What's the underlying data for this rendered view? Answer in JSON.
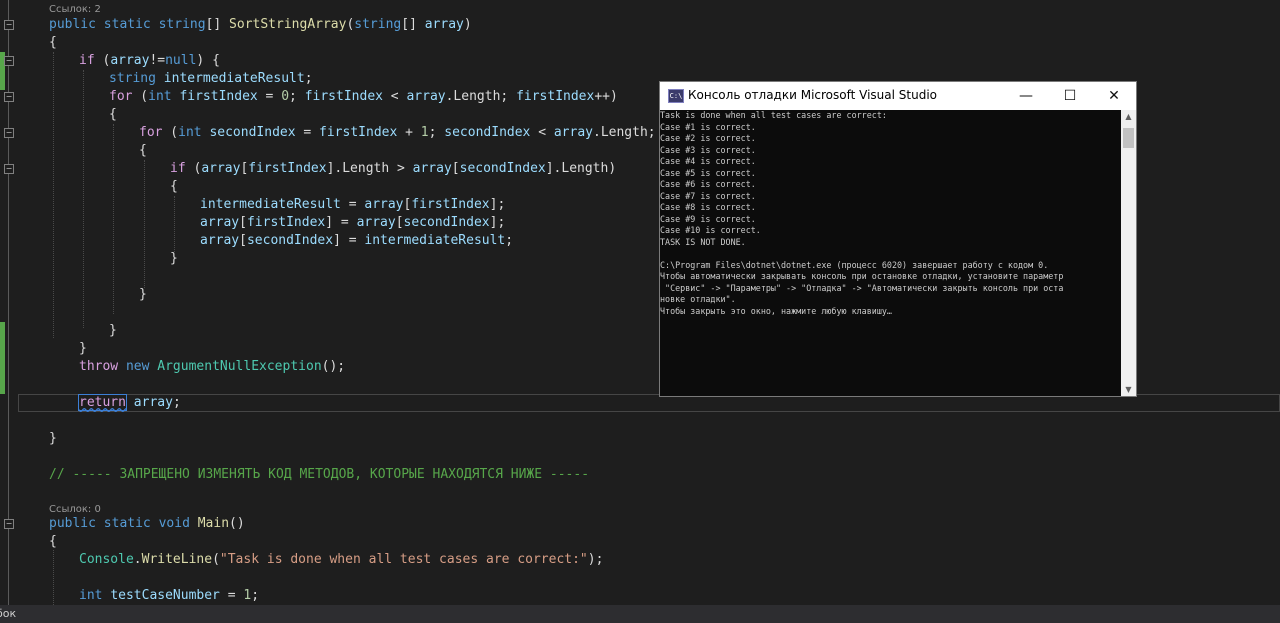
{
  "editor": {
    "refs_sort": "Ссылок: 2",
    "refs_main": "Ссылок: 0",
    "code": {
      "sig": {
        "kw1": "public",
        "kw2": "static",
        "type": "string",
        "arr": "[] ",
        "fn": "SortStringArray",
        "p1": "(",
        "ptype": "string",
        "p2": "[] ",
        "pname": "array",
        "p3": ")"
      },
      "l2": "{",
      "l3": {
        "ctl": "if",
        "a": " (",
        "v": "array",
        "b": "!=",
        "kw": "null",
        "c": ") {"
      },
      "l4": {
        "kw": "string",
        "v": "intermediateResult",
        "c": ";"
      },
      "l5": {
        "ctl": "for",
        "a": " (",
        "kw": "int",
        "v1": "firstIndex",
        "b": " = ",
        "num": "0",
        "c": "; ",
        "v2": "firstIndex",
        "d": " < ",
        "v3": "array",
        "e": ".Length; ",
        "v4": "firstIndex",
        "f": "++)"
      },
      "l6": "{",
      "l7": {
        "ctl": "for",
        "a": " (",
        "kw": "int",
        "v1": "secondIndex",
        "b": " = ",
        "v2": "firstIndex",
        "c": " + ",
        "num": "1",
        "d": "; ",
        "v3": "secondIndex",
        "e": " < ",
        "v4": "array",
        "f": ".Length; se"
      },
      "l8": "{",
      "l9": {
        "ctl": "if",
        "a": " (",
        "v1": "array",
        "b": "[",
        "v2": "firstIndex",
        "c": "].Length > ",
        "v3": "array",
        "d": "[",
        "v4": "secondIndex",
        "e": "].Length)"
      },
      "l10": "{",
      "l11": {
        "v1": "intermediateResult",
        "a": " = ",
        "v2": "array",
        "b": "[",
        "v3": "firstIndex",
        "c": "];"
      },
      "l12": {
        "v1": "array",
        "a": "[",
        "v2": "firstIndex",
        "b": "] = ",
        "v3": "array",
        "c": "[",
        "v4": "secondIndex",
        "d": "];"
      },
      "l13": {
        "v1": "array",
        "a": "[",
        "v2": "secondIndex",
        "b": "] = ",
        "v3": "intermediateResult",
        "c": ";"
      },
      "l14": "}",
      "l15": "}",
      "l16": "}",
      "l17": "}",
      "l18": {
        "ctl": "throw",
        "kw": "new",
        "ty": "ArgumentNullException",
        "c": "();"
      },
      "l19": {
        "ctl": "return",
        "v": "array",
        "c": ";"
      },
      "l20": "}",
      "l21": "// ----- ЗАПРЕЩЕНО ИЗМЕНЯТЬ КОД МЕТОДОВ, КОТОРЫЕ НАХОДЯТСЯ НИЖЕ -----",
      "main": {
        "kw1": "public",
        "kw2": "static",
        "kw3": "void",
        "fn": "Main",
        "c": "()"
      },
      "l23": "{",
      "l24": {
        "ty": "Console",
        "a": ".",
        "fn": "WriteLine",
        "b": "(",
        "str": "\"Task is done when all test cases are correct:\"",
        "c": ");"
      },
      "l25": {
        "kw": "int",
        "v": "testCaseNumber",
        "a": " = ",
        "num": "1",
        "c": ";"
      }
    }
  },
  "statusbar": {
    "text": "бок"
  },
  "console": {
    "title": "Консоль отладки Microsoft Visual Studio",
    "icon_text": "C:\\",
    "minimize": "—",
    "maximize": "☐",
    "close": "✕",
    "output": "Task is done when all test cases are correct:\nCase #1 is correct.\nCase #2 is correct.\nCase #3 is correct.\nCase #4 is correct.\nCase #5 is correct.\nCase #6 is correct.\nCase #7 is correct.\nCase #8 is correct.\nCase #9 is correct.\nCase #10 is correct.\nTASK IS NOT DONE.\n\nC:\\Program Files\\dotnet\\dotnet.exe (процесс 6020) завершает работу с кодом 0.\nЧтобы автоматически закрывать консоль при остановке отладки, установите параметр\n \"Сервис\" -> \"Параметры\" -> \"Отладка\" -> \"Автоматически закрыть консоль при оста\nновке отладки\".\nЧтобы закрыть это окно, нажмите любую клавишу…"
  },
  "colors": {
    "background": "#1e1e1e",
    "keyword": "#569cd6",
    "control": "#d8a0df",
    "type": "#4ec9b0",
    "method": "#dcdcaa",
    "variable": "#9cdcfe",
    "comment": "#57a64a",
    "string": "#d69d85"
  }
}
